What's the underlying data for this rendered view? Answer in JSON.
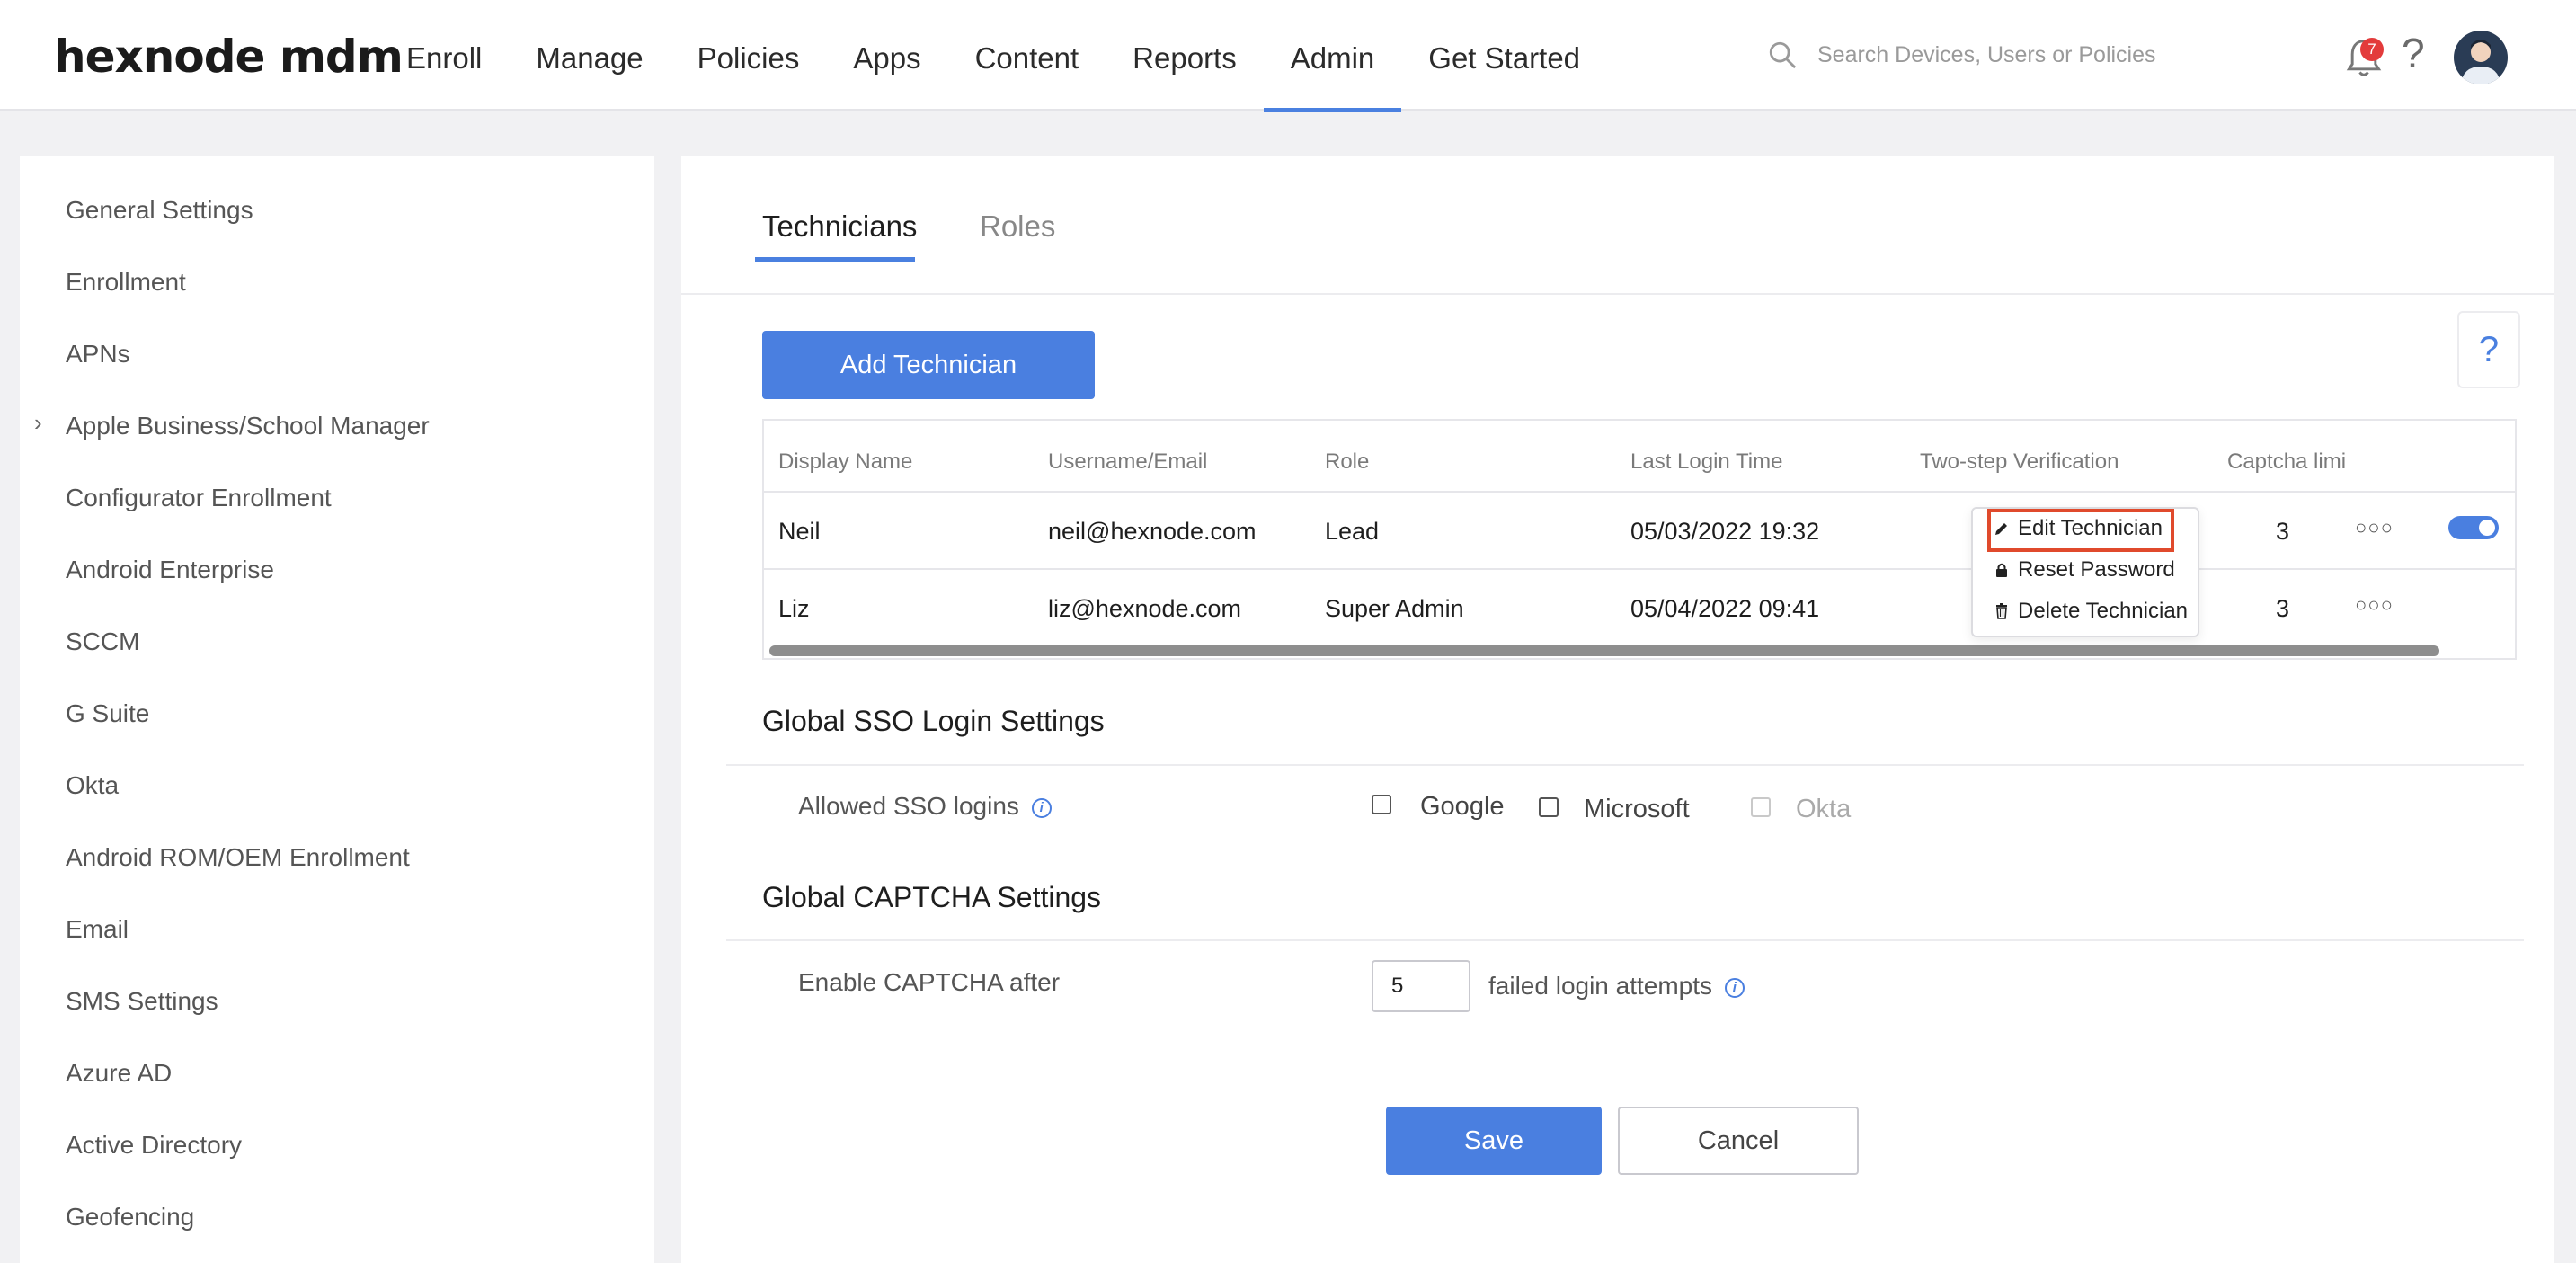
{
  "app": {
    "logo": "hexnode mdm"
  },
  "nav": {
    "items": [
      {
        "label": "Enroll"
      },
      {
        "label": "Manage"
      },
      {
        "label": "Policies"
      },
      {
        "label": "Apps"
      },
      {
        "label": "Content"
      },
      {
        "label": "Reports"
      },
      {
        "label": "Admin"
      },
      {
        "label": "Get Started"
      }
    ],
    "active": "Admin",
    "search_placeholder": "Search Devices, Users or Policies",
    "notification_count": "7",
    "help": "?"
  },
  "sidebar": {
    "items": [
      {
        "label": "General Settings"
      },
      {
        "label": "Enrollment"
      },
      {
        "label": "APNs"
      },
      {
        "label": "Apple Business/School Manager"
      },
      {
        "label": "Configurator Enrollment"
      },
      {
        "label": "Android Enterprise"
      },
      {
        "label": "SCCM"
      },
      {
        "label": "G Suite"
      },
      {
        "label": "Okta"
      },
      {
        "label": "Android ROM/OEM Enrollment"
      },
      {
        "label": "Email"
      },
      {
        "label": "SMS Settings"
      },
      {
        "label": "Azure AD"
      },
      {
        "label": "Active Directory"
      },
      {
        "label": "Geofencing"
      }
    ],
    "chevron": "›"
  },
  "main": {
    "tabs": [
      {
        "label": "Technicians"
      },
      {
        "label": "Roles"
      }
    ],
    "help": "?",
    "add_button": "Add Technician",
    "table": {
      "columns": [
        "Display Name",
        "Username/Email",
        "Role",
        "Last Login Time",
        "Two-step Verification",
        "Captcha limi"
      ],
      "rows": [
        {
          "name": "Neil",
          "email": "neil@hexnode.com",
          "role": "Lead",
          "last_login": "05/03/2022 19:32",
          "captcha": "3",
          "more": "○○○",
          "enabled": true
        },
        {
          "name": "Liz",
          "email": "liz@hexnode.com",
          "role": "Super Admin",
          "last_login": "05/04/2022 09:41",
          "captcha": "3",
          "more": "○○○"
        }
      ]
    },
    "context_menu": {
      "items": [
        {
          "label": "Edit Technician",
          "icon": "pencil-icon"
        },
        {
          "label": "Reset Password",
          "icon": "lock-icon"
        },
        {
          "label": "Delete Technician",
          "icon": "trash-icon"
        }
      ],
      "highlight_color": "#e04a2c"
    },
    "sso": {
      "title": "Global SSO Login Settings",
      "label": "Allowed SSO logins",
      "info": "i",
      "options": [
        {
          "label": "Google",
          "checked": false,
          "disabled": false
        },
        {
          "label": "Microsoft",
          "checked": false,
          "disabled": false
        },
        {
          "label": "Okta",
          "checked": false,
          "disabled": true
        }
      ]
    },
    "captcha": {
      "title": "Global CAPTCHA Settings",
      "label": "Enable CAPTCHA after",
      "value": "5",
      "suffix": "failed login attempts",
      "info": "i"
    },
    "save": "Save",
    "cancel": "Cancel"
  },
  "colors": {
    "accent": "#4a7fe0",
    "badge": "#e33b3b",
    "highlight": "#e04a2c"
  }
}
